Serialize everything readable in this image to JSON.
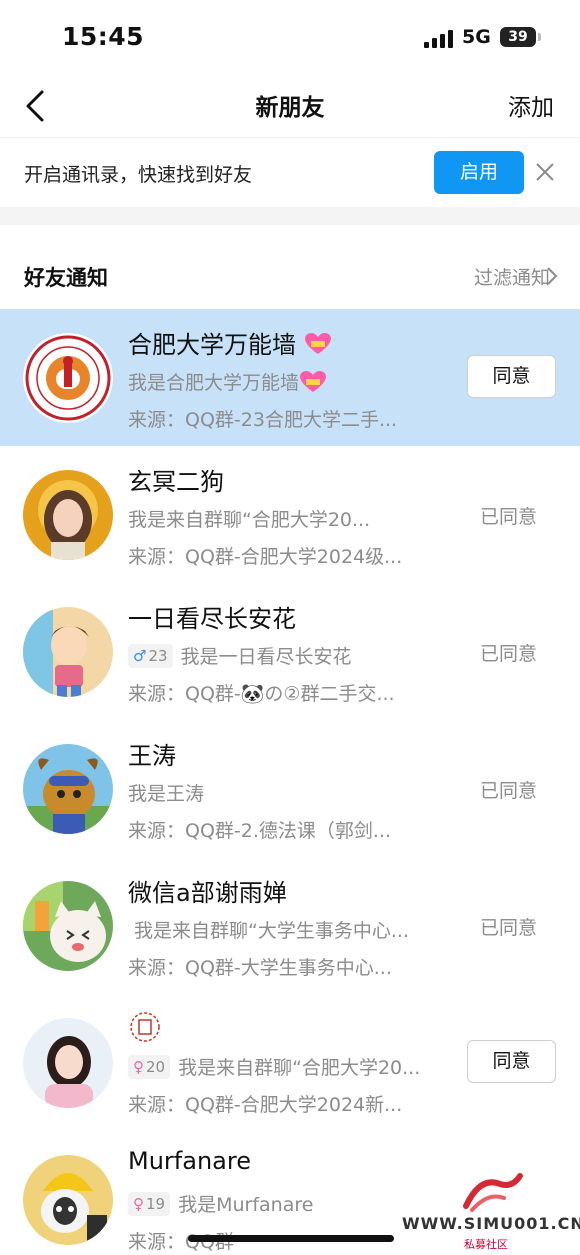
{
  "status_bar": {
    "time": "15:45",
    "network": "5G",
    "battery": "39"
  },
  "nav": {
    "back_icon": "chevron-left-icon",
    "title": "新朋友",
    "action": "添加"
  },
  "contacts_banner": {
    "text": "开启通讯录，快速找到好友",
    "enable_label": "启用",
    "close_icon": "close-icon"
  },
  "section": {
    "title": "好友通知",
    "filter_label": "过滤通知"
  },
  "requests": [
    {
      "name": "合肥大学万能墙",
      "message": "我是合肥大学万能墙",
      "source": "来源：QQ群-23合肥大学二手...",
      "status": "同意",
      "status_type": "button",
      "highlight": true
    },
    {
      "name": "玄冥二狗",
      "message": "我是来自群聊“合肥大学20...",
      "source": "来源：QQ群-合肥大学2024级...",
      "status": "已同意",
      "status_type": "label"
    },
    {
      "name": "一日看尽长安花",
      "badge": "♂23",
      "message": "我是一日看尽长安花",
      "source": "来源：QQ群-🐼の②群二手交...",
      "status": "已同意",
      "status_type": "label"
    },
    {
      "name": "王涛",
      "message": "我是王涛",
      "source": "来源：QQ群-2.德法课（郭剑...",
      "status": "已同意",
      "status_type": "label"
    },
    {
      "name": "微信a部谢雨婵",
      "message": "我是来自群聊“大学生事务中心...",
      "source": "来源：QQ群-大学生事务中心...",
      "status": "已同意",
      "status_type": "label"
    },
    {
      "name": "",
      "badge": "♀20",
      "message": "我是来自群聊“合肥大学20...",
      "source": "来源：QQ群-合肥大学2024新...",
      "status": "同意",
      "status_type": "button"
    },
    {
      "name": "Murfanare",
      "badge": "♀19",
      "message": "我是Murfanare",
      "source": "来源：QQ群",
      "status": "",
      "status_type": "none"
    }
  ],
  "watermark": {
    "text": "WWW.SIMU001.CN",
    "sub": "私募社区"
  },
  "colors": {
    "accent": "#0f97f3",
    "highlight_row": "#c7e2f8",
    "secondary_text": "#8c8c8c"
  }
}
